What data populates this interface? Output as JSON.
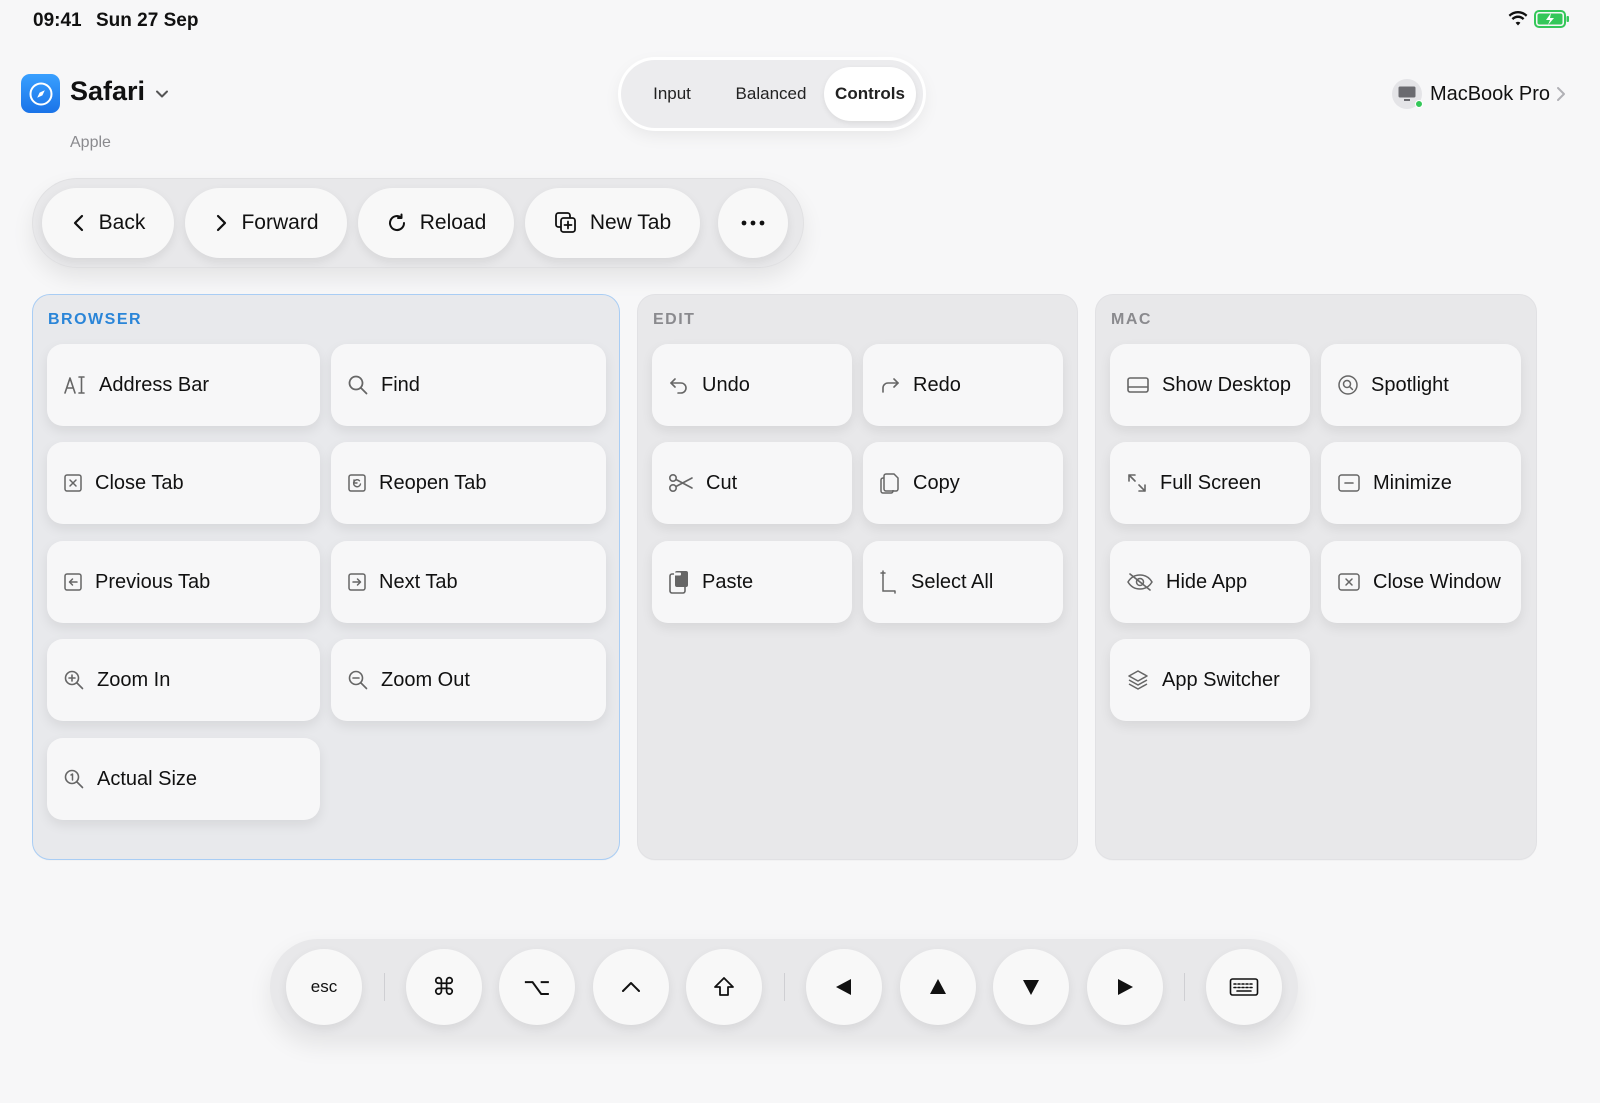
{
  "status_bar": {
    "time": "09:41",
    "date": "Sun 27 Sep"
  },
  "app": {
    "name": "Safari",
    "vendor": "Apple",
    "icon": "compass-icon"
  },
  "mode_switch": {
    "options": [
      "Input",
      "Balanced",
      "Controls"
    ],
    "selected": "Controls"
  },
  "device": {
    "name": "MacBook Pro",
    "status": "connected",
    "icon": "display-icon"
  },
  "toolbar": {
    "buttons": [
      {
        "label": "Back",
        "icon": "chevron-left-icon"
      },
      {
        "label": "Forward",
        "icon": "chevron-right-icon"
      },
      {
        "label": "Reload",
        "icon": "reload-icon"
      },
      {
        "label": "New Tab",
        "icon": "new-tab-icon"
      },
      {
        "label": "",
        "icon": "more-icon"
      }
    ]
  },
  "panels": {
    "browser": {
      "title": "BROWSER",
      "items": [
        {
          "label": "Address Bar",
          "icon": "text-cursor-icon"
        },
        {
          "label": "Find",
          "icon": "search-icon"
        },
        {
          "label": "Close Tab",
          "icon": "close-tab-icon"
        },
        {
          "label": "Reopen Tab",
          "icon": "reopen-tab-icon"
        },
        {
          "label": "Previous Tab",
          "icon": "previous-tab-icon"
        },
        {
          "label": "Next Tab",
          "icon": "next-tab-icon"
        },
        {
          "label": "Zoom In",
          "icon": "zoom-in-icon"
        },
        {
          "label": "Zoom Out",
          "icon": "zoom-out-icon"
        },
        {
          "label": "Actual Size",
          "icon": "actual-size-icon"
        }
      ]
    },
    "edit": {
      "title": "EDIT",
      "items": [
        {
          "label": "Undo",
          "icon": "undo-icon"
        },
        {
          "label": "Redo",
          "icon": "redo-icon"
        },
        {
          "label": "Cut",
          "icon": "scissors-icon"
        },
        {
          "label": "Copy",
          "icon": "copy-icon"
        },
        {
          "label": "Paste",
          "icon": "paste-icon"
        },
        {
          "label": "Select All",
          "icon": "select-all-icon"
        }
      ]
    },
    "mac": {
      "title": "MAC",
      "items": [
        {
          "label": "Show Desktop",
          "icon": "desktop-icon"
        },
        {
          "label": "Spotlight",
          "icon": "spotlight-icon"
        },
        {
          "label": "Full Screen",
          "icon": "full-screen-icon"
        },
        {
          "label": "Minimize",
          "icon": "minimize-icon"
        },
        {
          "label": "Hide App",
          "icon": "eye-slash-icon"
        },
        {
          "label": "Close Window",
          "icon": "close-window-icon"
        },
        {
          "label": "App Switcher",
          "icon": "layers-icon"
        }
      ]
    }
  },
  "keybar": {
    "keys": [
      {
        "label": "esc",
        "icon": ""
      },
      {
        "label": "⌘",
        "icon": "command-key-icon"
      },
      {
        "label": "⌥",
        "icon": "option-key-icon"
      },
      {
        "label": "",
        "icon": "control-key-icon"
      },
      {
        "label": "",
        "icon": "shift-key-icon"
      },
      {
        "label": "",
        "icon": "arrow-left-icon"
      },
      {
        "label": "",
        "icon": "arrow-up-icon"
      },
      {
        "label": "",
        "icon": "arrow-down-icon"
      },
      {
        "label": "",
        "icon": "arrow-right-icon"
      },
      {
        "label": "",
        "icon": "keyboard-icon"
      }
    ]
  },
  "colors": {
    "accent": "#2a85d8",
    "connected": "#34c759"
  }
}
